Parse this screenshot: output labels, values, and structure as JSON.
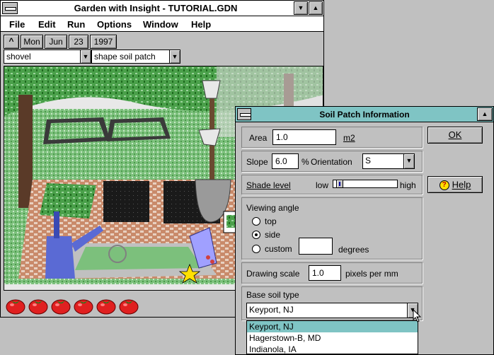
{
  "main_window": {
    "title": "Garden with Insight - TUTORIAL.GDN",
    "minimize_glyph": "▼",
    "maximize_glyph": "▲",
    "menu": [
      "File",
      "Edit",
      "Run",
      "Options",
      "Window",
      "Help"
    ],
    "up_glyph": "^",
    "date": {
      "weekday": "Mon",
      "month": "Jun",
      "day": "23",
      "year": "1997"
    },
    "tool_select": "shovel",
    "action_select": "shape soil patch",
    "tomato_count": 6
  },
  "dialog": {
    "title": "Soil Patch Information",
    "area_label": "Area",
    "area_value": "1.0",
    "area_unit": "m2",
    "slope_label": "Slope",
    "slope_value": "6.0",
    "slope_unit": "%",
    "orientation_label": "Orientation",
    "orientation_value": "S",
    "shade_label": "Shade level",
    "shade_low": "low",
    "shade_high": "high",
    "shade_level": 0.05,
    "viewing_angle_label": "Viewing angle",
    "view_top": "top",
    "view_side": "side",
    "view_custom": "custom",
    "view_selected": "side",
    "custom_degrees_value": "",
    "degrees_label": "degrees",
    "drawing_scale_label": "Drawing scale",
    "drawing_scale_value": "1.0",
    "drawing_scale_unit": "pixels per mm",
    "soil_type_label": "Base soil type",
    "soil_type_value": "Keyport, NJ",
    "soil_type_options": [
      "Keyport, NJ",
      "Hagerstown-B, MD",
      "Indianola, IA"
    ],
    "ok_label": "OK",
    "help_label": "Help",
    "help_icon": "question-mark-icon"
  },
  "colors": {
    "dialog_title_bg": "#7fc4c4",
    "list_selection": "#7fc4c4",
    "window_face": "#c0c0c0"
  }
}
